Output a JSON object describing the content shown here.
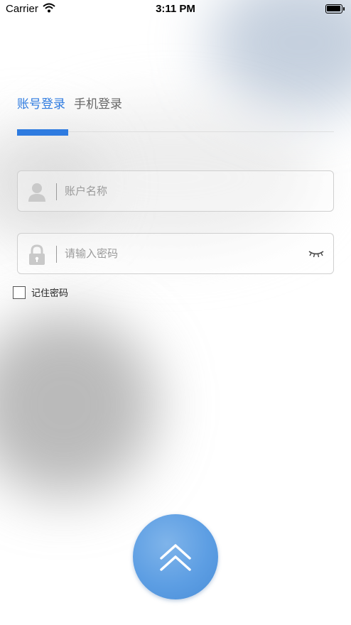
{
  "status_bar": {
    "carrier": "Carrier",
    "time": "3:11 PM"
  },
  "tabs": {
    "account_login": "账号登录",
    "phone_login": "手机登录",
    "active_color": "#2e7be0"
  },
  "form": {
    "username_placeholder": "账户名称",
    "password_placeholder": "请输入密码",
    "remember_label": "记住密码",
    "remember_checked": false
  },
  "icons": {
    "username": "user-icon",
    "password": "lock-icon",
    "visibility": "eye-closed-icon",
    "submit": "double-chevron-up-icon"
  },
  "colors": {
    "accent": "#2e7be0",
    "button": "#5d9ee3"
  }
}
